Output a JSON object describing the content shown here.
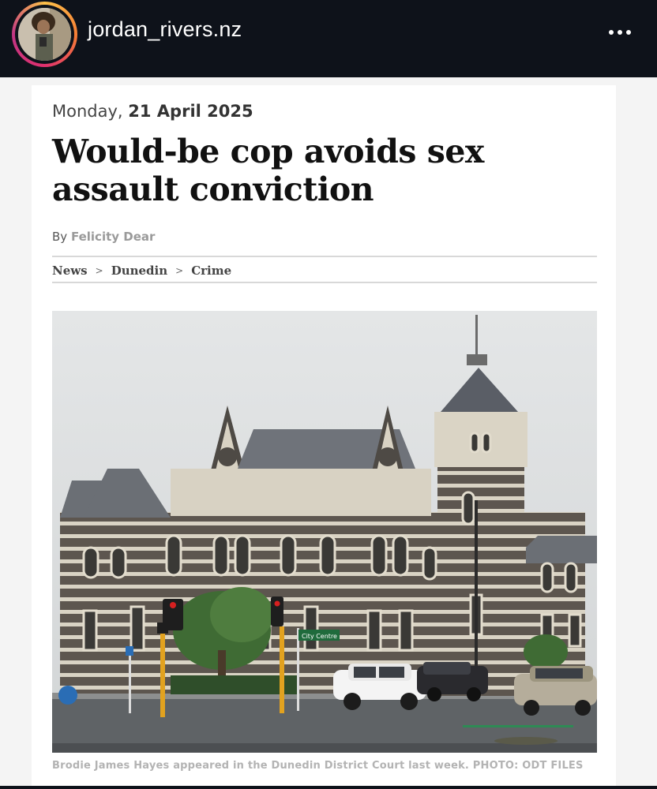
{
  "post_header": {
    "username": "jordan_rivers.nz",
    "more_icon": "more-horizontal-icon"
  },
  "article": {
    "date_weekday": "Monday,",
    "date_value": "21 April 2025",
    "headline": "Would-be cop avoids sex assault conviction",
    "byline_prefix": "By",
    "author": "Felicity Dear",
    "breadcrumb": [
      "News",
      "Dunedin",
      "Crime"
    ],
    "breadcrumb_separator": ">",
    "photo_signs": {
      "street_sign": "City Centre"
    },
    "caption": "Brodie James Hayes appeared in the Dunedin District Court last week. PHOTO: ODT FILES"
  },
  "colors": {
    "topbar": "#0e121a",
    "headline": "#111111",
    "author": "#9a9a9a"
  }
}
